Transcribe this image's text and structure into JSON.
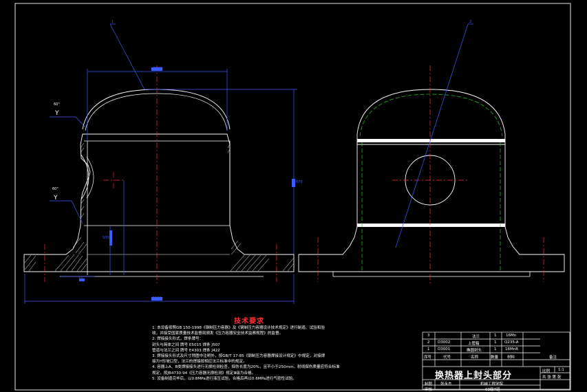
{
  "drawing": {
    "title": "换热器上封头部分",
    "notes_title": "技术要求",
    "notes": [
      "1. 本设备按照GB 150-1998《钢制压力容器》及《钢制压力容器设计技术规定》进行制造、试验和验",
      "   收，并接受国家质量技术监督局颁发《压力容器安全技术监察规程》的监督。",
      "2. 焊接接头形式，焊条牌号：",
      "   封头与简体之间 牌号 E5015 焊条 J507",
      "   管道与法兰之间 牌号 E4303 焊条 J422",
      "3. 焊接接头形式及尺寸除图中注明外，按GB/T 17-85《钢制压力容器焊接设计规定》中规定，对接焊",
      "   接为Y形坡口型，法兰的焊接按相应法兰标准中的规定。",
      "4. 容器上A、B类焊接接头进行无损检测检查，探伤长度为20%，且不小于250mm。射线探伤质量应符合标准",
      "   规定，按JB4730-94《压力容器无损检测》规定Ⅲ级为合格。",
      "5. 设备制造完毕后，以0.8MPa进行液压试验，合格后再以0.6MPa进行气密性试验。"
    ],
    "labels": {
      "callout_left": "1",
      "callout_right": "2",
      "weld_y_1": "Y",
      "weld_y_2": "Y",
      "weld_angle_1": "60°",
      "weld_angle_2": "60°",
      "dim_top": "Φ500",
      "dim_bottom": "Φ860",
      "dim_height": "670",
      "dim_inner_height": "500",
      "dim_bottom_thk": "10"
    }
  },
  "parts_table": {
    "headers": [
      "序号",
      "代号",
      "名称",
      "数量",
      "材料",
      "备注"
    ],
    "rows": [
      {
        "no": "3",
        "code": "",
        "name": "法兰",
        "qty": "1",
        "material": "16Mn",
        "note": ""
      },
      {
        "no": "2",
        "code": "D3002",
        "name": "上管箱",
        "qty": "1",
        "material": "Q235-A",
        "note": ""
      },
      {
        "no": "1",
        "code": "D3001",
        "name": "椭圆封头",
        "qty": "1",
        "material": "16MnR",
        "note": ""
      }
    ]
  },
  "title_block": {
    "scale_label": "比例",
    "scale_value": "1:1",
    "sheet_label": "共 张 第 张",
    "designer_label": "制图",
    "designer": "张永杰",
    "checker_label": "审核",
    "school": "机械工程学院",
    "class": "03级7班"
  }
}
